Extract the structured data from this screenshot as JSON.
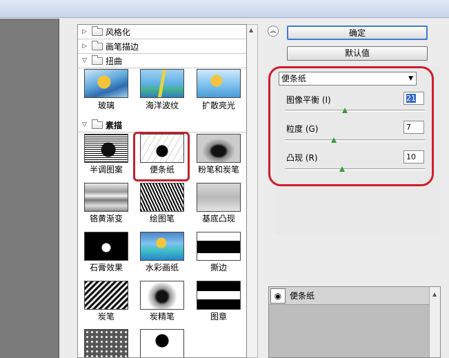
{
  "filter_browser": {
    "categories": [
      {
        "label": "风格化",
        "expanded": false
      },
      {
        "label": "画笔描边",
        "expanded": false
      },
      {
        "label": "扭曲",
        "expanded": true
      },
      {
        "label": "素描",
        "expanded": true
      }
    ],
    "distort_filters": [
      "玻璃",
      "海洋波纹",
      "扩散亮光"
    ],
    "sketch_filters": [
      "半调图案",
      "便条纸",
      "粉笔和炭笔",
      "铬黄渐变",
      "绘图笔",
      "基底凸现",
      "石膏效果",
      "水彩画纸",
      "撕边",
      "炭笔",
      "炭精笔",
      "图章"
    ],
    "selected": "便条纸"
  },
  "buttons": {
    "ok": "确定",
    "default": "默认值"
  },
  "settings": {
    "filter_select": "便条纸",
    "params": [
      {
        "label": "图像平衡 (I)",
        "value": "21",
        "fraction": 0.43
      },
      {
        "label": "粒度 (G)",
        "value": "7",
        "fraction": 0.35
      },
      {
        "label": "凸现 (R)",
        "value": "10",
        "fraction": 0.41
      }
    ]
  },
  "layers": {
    "items": [
      "便条纸"
    ]
  },
  "colors": {
    "highlight": "#d11a2b",
    "accent": "#3d7bd6"
  }
}
